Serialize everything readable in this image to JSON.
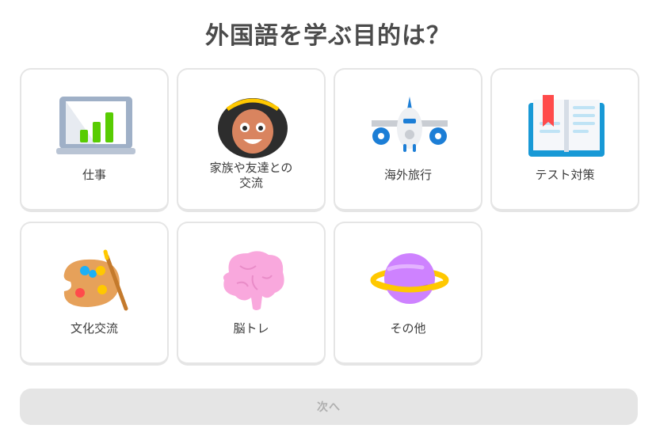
{
  "page": {
    "title": "外国語を学ぶ目的は？"
  },
  "options": [
    {
      "label": "仕事",
      "icon": "laptop-chart-icon"
    },
    {
      "label": "家族や友達との交流",
      "label_line1": "家族や友達との",
      "label_line2": "交流",
      "icon": "person-avatar-icon"
    },
    {
      "label": "海外旅行",
      "icon": "airplane-icon"
    },
    {
      "label": "テスト対策",
      "icon": "open-book-icon"
    },
    {
      "label": "文化交流",
      "icon": "paint-palette-icon"
    },
    {
      "label": "脳トレ",
      "icon": "brain-icon"
    },
    {
      "label": "その他",
      "icon": "planet-icon"
    }
  ],
  "footer": {
    "next_label": "次へ",
    "next_enabled": false
  },
  "colors": {
    "border": "#e5e5e5",
    "text": "#3c3c3c",
    "button_disabled_bg": "#e5e5e5",
    "button_disabled_text": "#afafaf"
  }
}
